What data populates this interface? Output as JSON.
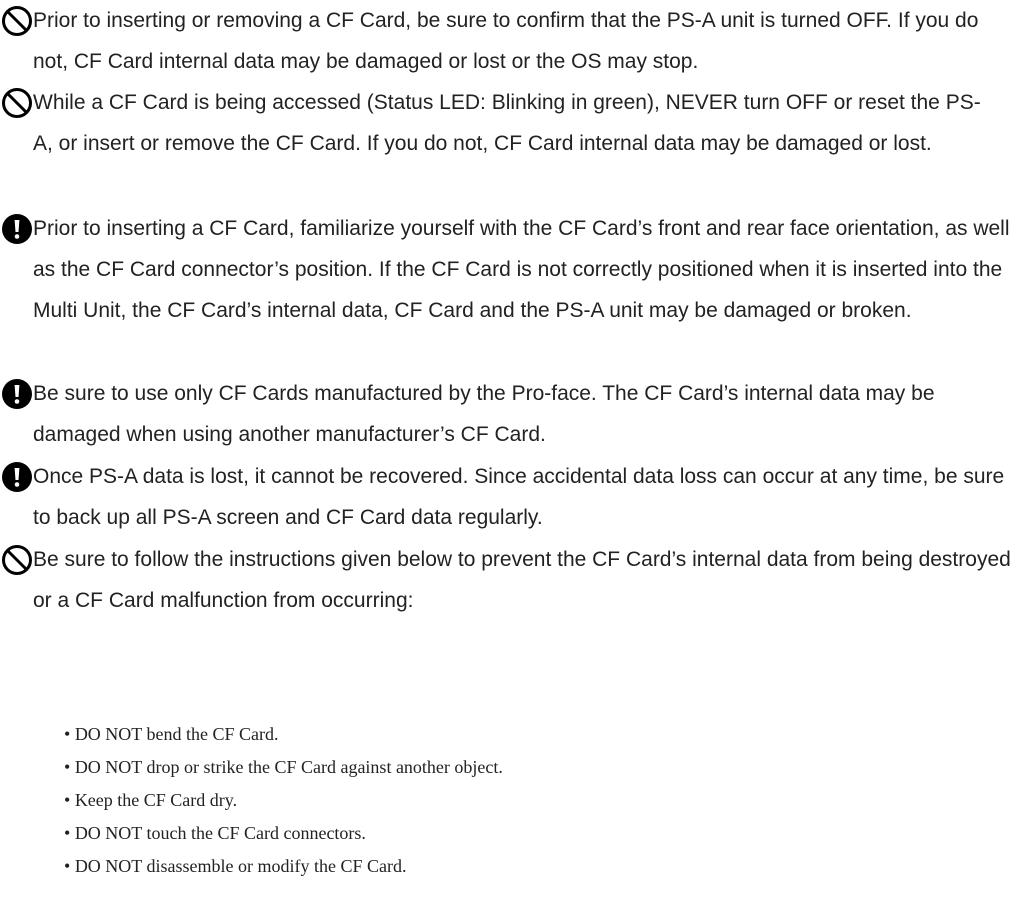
{
  "notices": [
    {
      "icon": "prohibition-icon",
      "text": "Prior to inserting or removing a CF Card, be sure to confirm that the PS-A unit is turned OFF. If you do not, CF Card internal data may be damaged or lost or the OS may stop."
    },
    {
      "icon": "prohibition-icon",
      "text": "While a CF Card is being accessed (Status LED: Blinking in green), NEVER turn OFF or reset the PS-A, or insert or remove the CF Card. If you do not, CF Card internal data may be damaged or lost."
    },
    {
      "icon": "caution-icon",
      "text": "Prior to inserting a CF Card, familiarize yourself with the CF Card’s front and rear face orientation, as well as the CF Card connector’s position. If the CF Card is not correctly positioned when it is inserted into the Multi Unit, the CF Card’s internal data, CF Card and the PS-A unit may be damaged or broken."
    },
    {
      "icon": "caution-icon",
      "text": "Be sure to use only CF Cards manufactured by the Pro-face. The CF Card’s internal data may be damaged when using another manufacturer’s CF Card."
    },
    {
      "icon": "caution-icon",
      "text": "Once PS-A data is lost, it cannot be recovered. Since accidental data loss can occur at any time, be sure to back up all PS-A screen and CF Card data regularly."
    },
    {
      "icon": "prohibition-icon",
      "text": "Be sure to follow the instructions given below to prevent the CF Card’s internal data from being destroyed or a CF Card malfunction from occurring:"
    }
  ],
  "bullets": [
    "DO NOT bend the CF Card.",
    "DO NOT drop or strike the CF Card against another object.",
    "Keep the CF Card dry.",
    "DO NOT touch the CF Card connectors.",
    "DO NOT disassemble or modify the CF Card."
  ]
}
